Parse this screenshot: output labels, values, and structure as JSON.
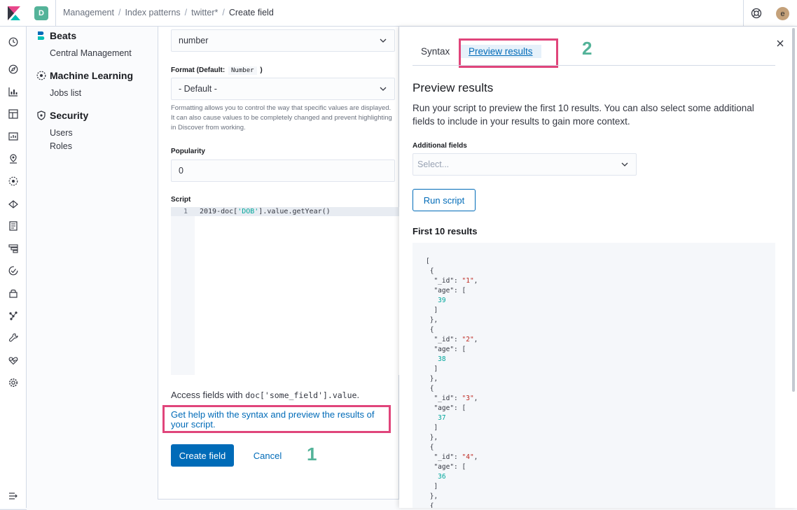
{
  "header": {
    "space_initial": "D",
    "user_initial": "e",
    "breadcrumbs": [
      "Management",
      "Index patterns",
      "twitter*",
      "Create field"
    ]
  },
  "nav_icons": [
    "clock-icon",
    "compass-icon",
    "visualize-icon",
    "dashboard-icon",
    "canvas-icon",
    "maps-icon",
    "ml-icon",
    "infrastructure-icon",
    "logs-icon",
    "apm-icon",
    "uptime-icon",
    "siem-icon",
    "graph-icon",
    "devtools-icon",
    "monitoring-icon",
    "management-gear-icon"
  ],
  "sidebar": {
    "beats": {
      "title": "Beats",
      "items": [
        "Central Management"
      ]
    },
    "ml": {
      "title": "Machine Learning",
      "items": [
        "Jobs list"
      ]
    },
    "security": {
      "title": "Security",
      "items": [
        "Users",
        "Roles"
      ]
    }
  },
  "form": {
    "type_value": "number",
    "format_label_prefix": "Format (Default:",
    "format_default_code": "Number",
    "format_label_suffix": ")",
    "format_value": "- Default -",
    "format_help": "Formatting allows you to control the way that specific values are displayed. It can also cause values to be completely changed and prevent highlighting in Discover from working.",
    "popularity_label": "Popularity",
    "popularity_value": "0",
    "script_label": "Script",
    "script_line_number": "1",
    "script_code_pre": "2019-doc[",
    "script_code_str": "'DOB'",
    "script_code_post": "].value.getYear()",
    "access_prefix": "Access fields with",
    "access_code": "doc['some_field'].value",
    "access_suffix": ".",
    "help_link": "Get help with the syntax and preview the results of your script.",
    "create_button": "Create field",
    "cancel_button": "Cancel"
  },
  "annotations": {
    "one": "1",
    "two": "2"
  },
  "flyout": {
    "tab_syntax": "Syntax",
    "tab_preview": "Preview results",
    "title": "Preview results",
    "description": "Run your script to preview the first 10 results. You can also select some additional fields to include in your results to gain more context.",
    "additional_fields_label": "Additional fields",
    "select_placeholder": "Select...",
    "run_button": "Run script",
    "results_title": "First 10 results",
    "results": [
      {
        "id": "1",
        "age": 39
      },
      {
        "id": "2",
        "age": 38
      },
      {
        "id": "3",
        "age": 37
      },
      {
        "id": "4",
        "age": 36
      }
    ]
  },
  "colors": {
    "primary": "#006bb8",
    "annotation": "#54b399",
    "highlight_box": "#e0457b"
  }
}
